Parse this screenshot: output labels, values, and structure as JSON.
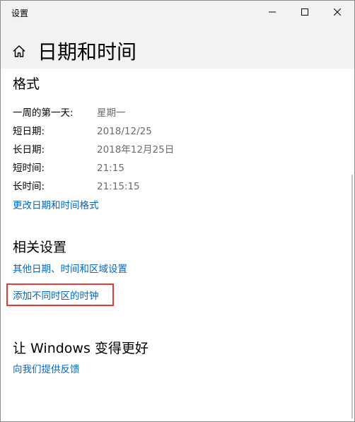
{
  "window": {
    "app_title": "设置",
    "caption_buttons": {
      "minimize": "minimize-icon",
      "maximize": "maximize-icon",
      "close": "close-icon"
    }
  },
  "header": {
    "home_icon": "home-icon",
    "page_title": "日期和时间"
  },
  "format_section": {
    "title": "格式",
    "rows": [
      {
        "label": "一周的第一天:",
        "value": "星期一"
      },
      {
        "label": "短日期:",
        "value": "2018/12/25"
      },
      {
        "label": "长日期:",
        "value": "2018年12月25日"
      },
      {
        "label": "短时间:",
        "value": "21:15"
      },
      {
        "label": "长时间:",
        "value": "21:15:15"
      }
    ],
    "change_link": "更改日期和时间格式"
  },
  "related_section": {
    "title": "相关设置",
    "links": [
      "其他日期、时间和区域设置",
      "添加不同时区的时钟"
    ],
    "highlight_color": "#e33a3a"
  },
  "windows_section": {
    "title": "让 Windows 变得更好",
    "link": "向我们提供反馈"
  },
  "colors": {
    "link": "#0067c0",
    "value_text": "#6b6b6b",
    "chrome_bg": "#f2f2f2"
  }
}
